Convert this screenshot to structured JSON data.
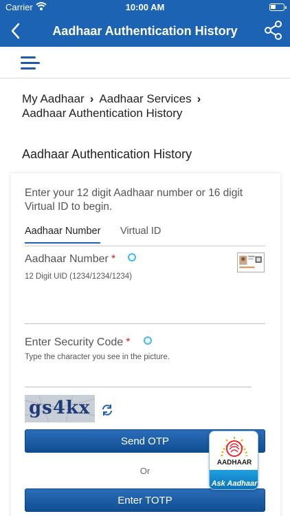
{
  "status_bar": {
    "carrier": "Carrier",
    "time": "10:00 AM"
  },
  "nav": {
    "title": "Aadhaar Authentication History",
    "back_icon": "chevron-left-icon",
    "share_icon": "share-icon"
  },
  "menu": {
    "icon": "hamburger-menu-icon"
  },
  "breadcrumb": {
    "items": [
      "My Aadhaar",
      "Aadhaar Services",
      "Aadhaar Authentication History"
    ],
    "separator": "›"
  },
  "page_heading": "Aadhaar Authentication History",
  "form": {
    "intro": "Enter your 12 digit Aadhaar number or 16 digit Virtual ID to begin.",
    "tabs": [
      {
        "label": "Aadhaar Number",
        "active": true
      },
      {
        "label": "Virtual ID",
        "active": false
      }
    ],
    "aadhaar_label": "Aadhaar Number",
    "aadhaar_placeholder": "12 Digit UID (1234/1234/1234)",
    "aadhaar_value": "",
    "required_mark": "*",
    "security_label": "Enter Security Code",
    "security_hint": "Type the character you see in the picture.",
    "security_value": "",
    "captcha_text": "gs4kx",
    "send_otp_label": "Send OTP",
    "or_label": "Or",
    "enter_totp_label": "Enter TOTP"
  },
  "ask_aadhaar": {
    "brand": "AADHAAR",
    "label": "Ask Aadhaar"
  },
  "colors": {
    "primary": "#1d63b4",
    "required": "#e02020",
    "info": "#4ab8e8"
  }
}
